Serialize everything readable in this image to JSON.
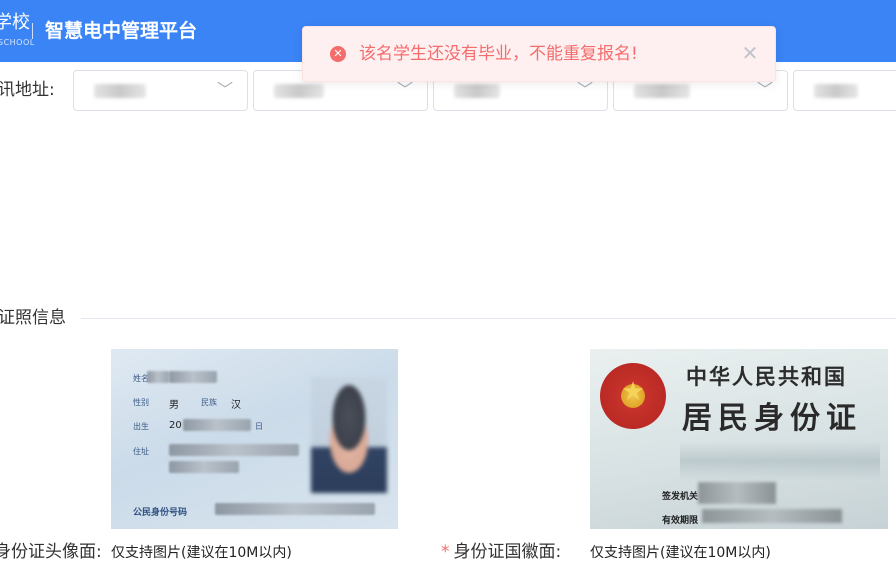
{
  "header": {
    "logo_text": "学校",
    "logo_sub": "SCHOOL",
    "app_title": "智慧电中管理平台",
    "background_color": "#3a84f6"
  },
  "toast": {
    "type": "error",
    "icon": "error-circle-icon",
    "message": "该名学生还没有毕业，不能重复报名!",
    "close_icon": "close-icon",
    "color": "#f56c6c"
  },
  "address": {
    "label": "讯地址:",
    "selects": [
      {
        "icon": "chevron-down-icon"
      },
      {
        "icon": "chevron-down-icon"
      },
      {
        "icon": "chevron-down-icon"
      },
      {
        "icon": "chevron-down-icon"
      },
      {}
    ]
  },
  "section": {
    "title": "证照信息"
  },
  "id_front": {
    "name_label": "姓名",
    "gender_label": "性别",
    "gender_value": "男",
    "ethnicity_label": "民族",
    "ethnicity_value": "汉",
    "birth_label": "出生",
    "birth_prefix": "20",
    "birth_day_suffix": "日",
    "address_label": "住址",
    "id_number_label": "公民身份号码",
    "caption_label": "身份证头像面:",
    "hint": "仅支持图片(建议在10M以内)"
  },
  "id_back": {
    "title_line1": "中华人民共和国",
    "title_line2": "居民身份证",
    "issuer_label": "签发机关",
    "validity_label": "有效期限",
    "required_mark": "*",
    "caption_label": "身份证国徽面:",
    "hint": "仅支持图片(建议在10M以内)"
  }
}
